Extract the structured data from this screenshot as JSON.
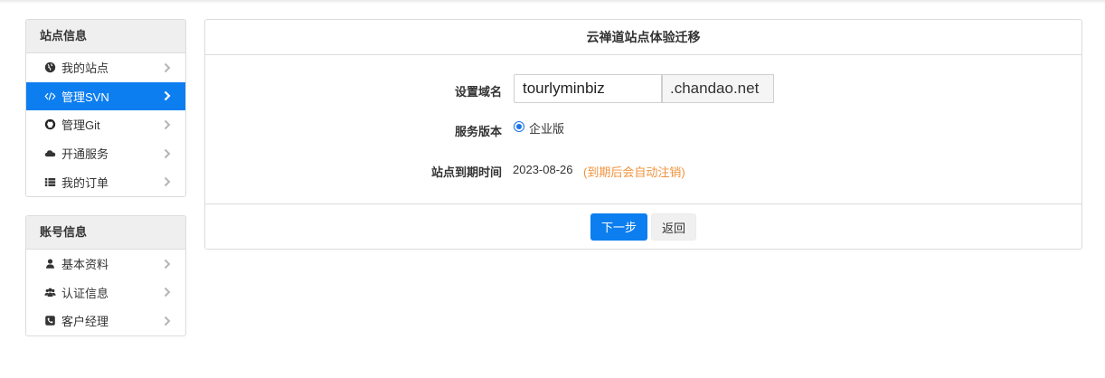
{
  "sidebar": {
    "site_panel": {
      "title": "站点信息",
      "items": [
        {
          "label": "我的站点",
          "icon": "globe-icon"
        },
        {
          "label": "管理SVN",
          "icon": "code-icon"
        },
        {
          "label": "管理Git",
          "icon": "github-icon"
        },
        {
          "label": "开通服务",
          "icon": "cloud-icon"
        },
        {
          "label": "我的订单",
          "icon": "list-icon"
        }
      ],
      "active_index": 1
    },
    "account_panel": {
      "title": "账号信息",
      "items": [
        {
          "label": "基本资料",
          "icon": "user-icon"
        },
        {
          "label": "认证信息",
          "icon": "users-icon"
        },
        {
          "label": "客户经理",
          "icon": "phone-icon"
        }
      ]
    }
  },
  "main": {
    "title": "云禅道站点体验迁移",
    "domain": {
      "label": "设置域名",
      "value": "tourlyminbiz",
      "suffix": ".chandao.net"
    },
    "version": {
      "label": "服务版本",
      "option": "企业版",
      "selected": true
    },
    "expire": {
      "label": "站点到期时间",
      "date": "2023-08-26",
      "note": "(到期后会自动注销)"
    },
    "buttons": {
      "next": "下一步",
      "back": "返回"
    }
  },
  "colors": {
    "accent": "#0c7ef0",
    "note": "#f0923a",
    "panel_header_bg": "#efefef",
    "border": "#dcdcdc"
  }
}
